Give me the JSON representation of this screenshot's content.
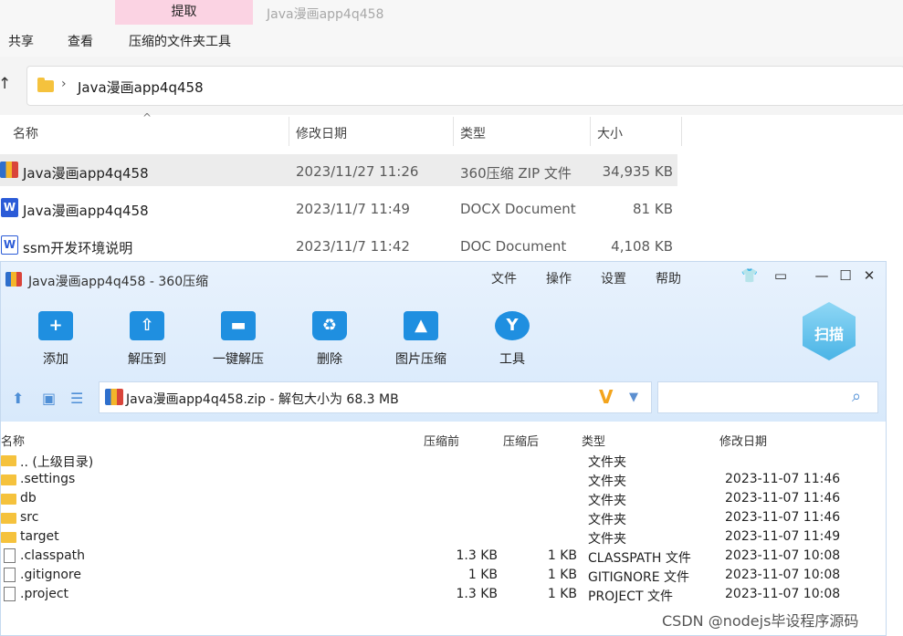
{
  "explorer": {
    "context_tab": "提取",
    "context_group_title": "Java漫画app4q458",
    "ribbon_tabs": [
      "共享",
      "查看",
      "压缩的文件夹工具"
    ],
    "address": {
      "path": "Java漫画app4q458"
    },
    "columns": {
      "name": "名称",
      "modified": "修改日期",
      "type": "类型",
      "size": "大小"
    },
    "files": [
      {
        "name": "Java漫画app4q458",
        "modified": "2023/11/27 11:26",
        "type": "360压缩 ZIP 文件",
        "size": "34,935 KB",
        "icon": "zip-archive-icon",
        "selected": true
      },
      {
        "name": "Java漫画app4q458",
        "modified": "2023/11/7 11:49",
        "type": "DOCX Document",
        "size": "81 KB",
        "icon": "word-docx-icon",
        "selected": false
      },
      {
        "name": "ssm开发环境说明",
        "modified": "2023/11/7 11:42",
        "type": "DOC Document",
        "size": "4,108 KB",
        "icon": "word-doc-icon",
        "selected": false
      }
    ]
  },
  "zip_window": {
    "title": "Java漫画app4q458 - 360压缩",
    "menu": [
      "文件",
      "操作",
      "设置",
      "帮助"
    ],
    "window_controls": {
      "skin": "👕",
      "feedback": "▭",
      "minimize": "—",
      "maximize": "☐",
      "close": "✕"
    },
    "toolbar": [
      {
        "label": "添加",
        "icon": "add-icon",
        "glyph": "+"
      },
      {
        "label": "解压到",
        "icon": "extract-to-icon",
        "glyph": "⇧"
      },
      {
        "label": "一键解压",
        "icon": "one-click-extract-icon",
        "glyph": "▬"
      },
      {
        "label": "删除",
        "icon": "delete-icon",
        "glyph": "♻"
      },
      {
        "label": "图片压缩",
        "icon": "image-compress-icon",
        "glyph": "▲"
      },
      {
        "label": "工具",
        "icon": "tools-icon",
        "glyph": "Y"
      }
    ],
    "scan_label": "扫描",
    "path_text": "Java漫画app4q458.zip - 解包大小为 68.3 MB",
    "path_badge": "V",
    "columns": {
      "name": "名称",
      "before": "压缩前",
      "after": "压缩后",
      "type": "类型",
      "modified": "修改日期"
    },
    "entries": [
      {
        "name": ".. (上级目录)",
        "before": "",
        "after": "",
        "type": "文件夹",
        "modified": "",
        "kind": "folder"
      },
      {
        "name": ".settings",
        "before": "",
        "after": "",
        "type": "文件夹",
        "modified": "2023-11-07 11:46",
        "kind": "folder"
      },
      {
        "name": "db",
        "before": "",
        "after": "",
        "type": "文件夹",
        "modified": "2023-11-07 11:46",
        "kind": "folder"
      },
      {
        "name": "src",
        "before": "",
        "after": "",
        "type": "文件夹",
        "modified": "2023-11-07 11:46",
        "kind": "folder"
      },
      {
        "name": "target",
        "before": "",
        "after": "",
        "type": "文件夹",
        "modified": "2023-11-07 11:49",
        "kind": "folder"
      },
      {
        "name": ".classpath",
        "before": "1.3 KB",
        "after": "1 KB",
        "type": "CLASSPATH 文件",
        "modified": "2023-11-07 10:08",
        "kind": "file"
      },
      {
        "name": ".gitignore",
        "before": "1 KB",
        "after": "1 KB",
        "type": "GITIGNORE 文件",
        "modified": "2023-11-07 10:08",
        "kind": "file"
      },
      {
        "name": ".project",
        "before": "1.3 KB",
        "after": "1 KB",
        "type": "PROJECT 文件",
        "modified": "2023-11-07 10:08",
        "kind": "file"
      }
    ]
  },
  "watermark": "CSDN @nodejs毕设程序源码"
}
